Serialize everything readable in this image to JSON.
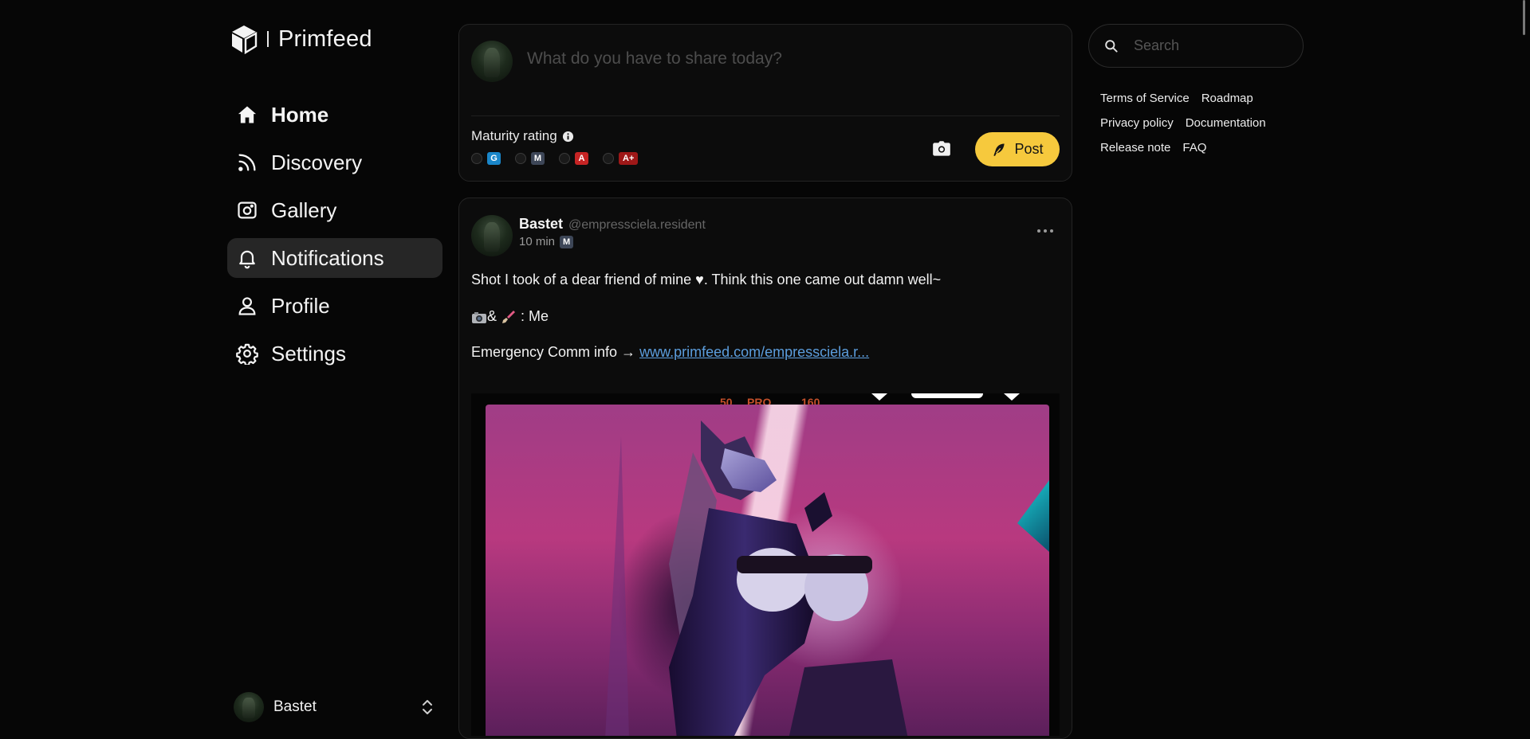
{
  "app": {
    "name": "Primfeed"
  },
  "nav": {
    "items": [
      {
        "label": "Home",
        "icon": "home-icon",
        "active": false
      },
      {
        "label": "Discovery",
        "icon": "rss-icon",
        "active": false
      },
      {
        "label": "Gallery",
        "icon": "gallery-icon",
        "active": false
      },
      {
        "label": "Notifications",
        "icon": "bell-icon",
        "active": true
      },
      {
        "label": "Profile",
        "icon": "user-icon",
        "active": false
      },
      {
        "label": "Settings",
        "icon": "gear-icon",
        "active": false
      }
    ]
  },
  "current_user": {
    "name": "Bastet"
  },
  "composer": {
    "placeholder": "What do you have to share today?",
    "maturity_label": "Maturity rating",
    "ratings": [
      "G",
      "M",
      "A",
      "A+"
    ],
    "post_label": "Post"
  },
  "post": {
    "author": "Bastet",
    "handle": "@empressciela.resident",
    "time": "10 min",
    "rating": "M",
    "line1": "Shot I took of a dear friend of mine ♥. Think this one came out damn well~",
    "line2_amp": "&",
    "line2_rest": ": Me",
    "line3_prefix": "Emergency Comm info → ",
    "line3_link": "www.primfeed.com/empressciela.r...",
    "image_frame_text": [
      "50",
      "PRO",
      "160"
    ]
  },
  "search": {
    "placeholder": "Search"
  },
  "footer_links": [
    [
      "Terms of Service",
      "Roadmap"
    ],
    [
      "Privacy policy",
      "Documentation"
    ],
    [
      "Release note",
      "FAQ"
    ]
  ],
  "colors": {
    "accent": "#f6c93d",
    "link": "#5c9ede",
    "badge_g": "#1a86c9",
    "badge_m": "#3d4657",
    "badge_a": "#c62424",
    "badge_a_plus": "#9e1818"
  }
}
